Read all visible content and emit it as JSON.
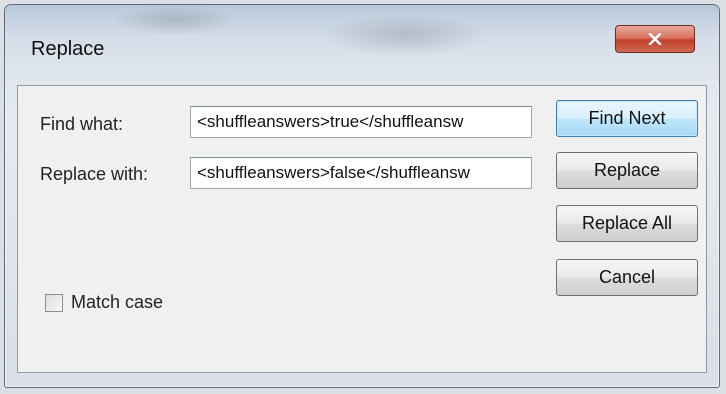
{
  "dialog": {
    "title": "Replace",
    "close_icon": "close-icon"
  },
  "find": {
    "label": "Find what:",
    "value": "<shuffleanswers>true</shuffleansw"
  },
  "replace": {
    "label": "Replace with:",
    "value": "<shuffleanswers>false</shuffleansw"
  },
  "buttons": {
    "find_next": "Find Next",
    "replace": "Replace",
    "replace_all": "Replace All",
    "cancel": "Cancel"
  },
  "options": {
    "match_case_label": "Match case",
    "match_case_checked": false
  },
  "colors": {
    "close_button": "#c1412a",
    "default_button_border": "#3c7fb1"
  }
}
